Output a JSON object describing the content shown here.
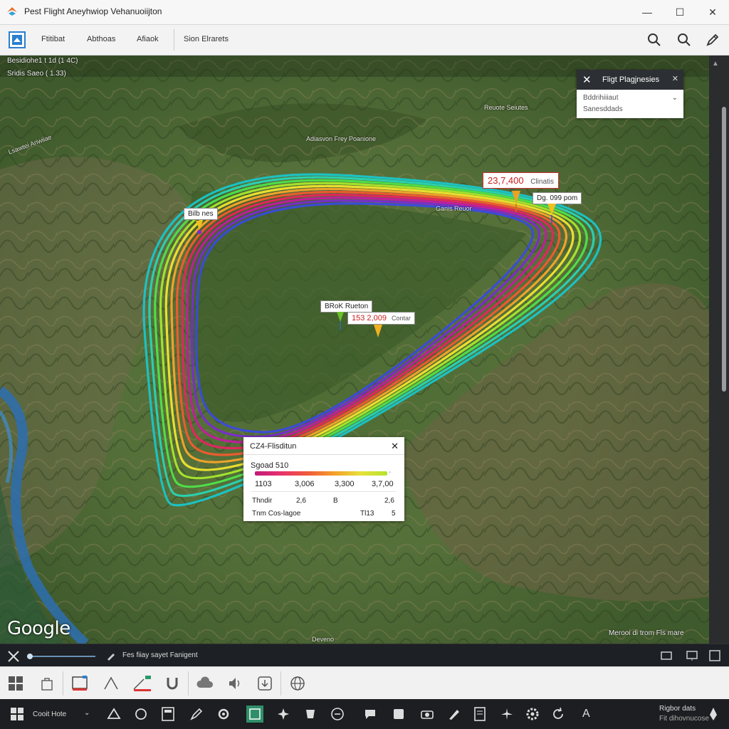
{
  "window": {
    "title": "Pest Flight Aneyhwiop Vehanuoiijton",
    "minimize": "—",
    "maximize": "☐",
    "close": "✕"
  },
  "menu": {
    "items": [
      "Ftitibat",
      "Abthoas",
      "Afiaok",
      "Sion Elrarets"
    ],
    "icons": [
      "search-icon",
      "zoom-icon",
      "pen-icon"
    ]
  },
  "map": {
    "overlay_lines": [
      "Besidiohe1 t 1d (1 4C)",
      "Sridis Saeo ( 1.33)"
    ],
    "center_label": "Adiasvon Frey Poanione",
    "place_labels": [
      "Lsawtei Ariwiiae",
      "Reuote Seiutes",
      "Ganis Reuor"
    ],
    "google": "Google",
    "attribution": "Merooi di trom Fls mare",
    "bottom_label": "Deveno"
  },
  "callouts": [
    {
      "text": "Bilb nes",
      "color": "#333333"
    },
    {
      "red": "23,7,400",
      "gray": "Clinatis"
    },
    {
      "text": "Dg. 099 pom",
      "color": "#333333"
    },
    {
      "text": "BRoK Rueton",
      "color": "#333333"
    },
    {
      "red": "153 2,009",
      "gray": "Contar"
    }
  ],
  "panel": {
    "title": "Fligt Plagjnesies",
    "line1": "Bddrihiiiaut",
    "line2": "Sanesddads"
  },
  "legend": {
    "title": "CZ4-Flisditun",
    "scale_label": "Sgoad 510",
    "ticks": [
      "1103",
      "3,006",
      "3,300",
      "3,7,00"
    ],
    "row2": [
      "Thndir",
      "2,6",
      "B",
      "2,6"
    ],
    "row3": [
      "Tnm Cos-lagoe",
      "Tl13",
      "5"
    ]
  },
  "flight_path": {
    "color_order": [
      "#18c6c9",
      "#27d5b5",
      "#4fe34a",
      "#a8e82c",
      "#f2e52e",
      "#f7a52a",
      "#f45a2e",
      "#e8245e",
      "#c41aa0",
      "#7b2bd0",
      "#3a4ae0"
    ]
  },
  "statusbar": {
    "label": "Fes fiiay sayet Fanigent"
  },
  "taskbar": {
    "search_text": "Cooit Hote",
    "clock": "Rigbor dats",
    "clock2": "Fit dihovnucose",
    "letter": "A"
  }
}
